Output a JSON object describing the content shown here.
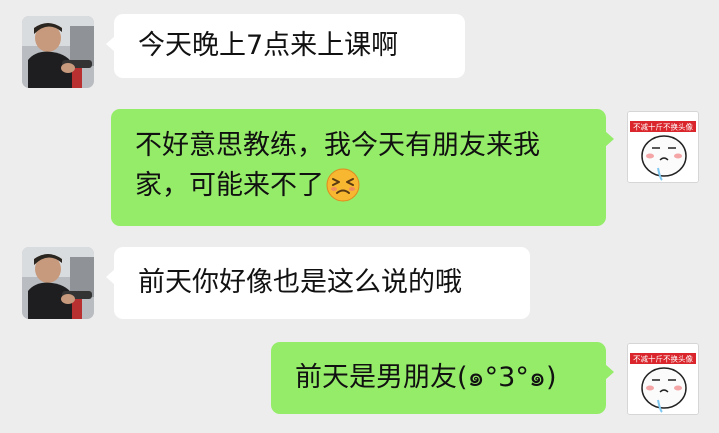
{
  "messages": [
    {
      "side": "left",
      "text": "今天晚上7点来上课啊"
    },
    {
      "side": "right",
      "text": "不好意思教练，我今天有朋友来我家，可能来不了",
      "emoji": "persevering-face-emoji"
    },
    {
      "side": "left",
      "text": "前天你好像也是这么说的哦"
    },
    {
      "side": "right",
      "text": "前天是男朋友(๑°3°๑)"
    }
  ],
  "sticker": {
    "band_text": "不减十斤不换头像"
  },
  "colors": {
    "background": "#ededed",
    "left_bubble": "#ffffff",
    "right_bubble": "#95ec69",
    "sticker_band": "#d9252b"
  }
}
